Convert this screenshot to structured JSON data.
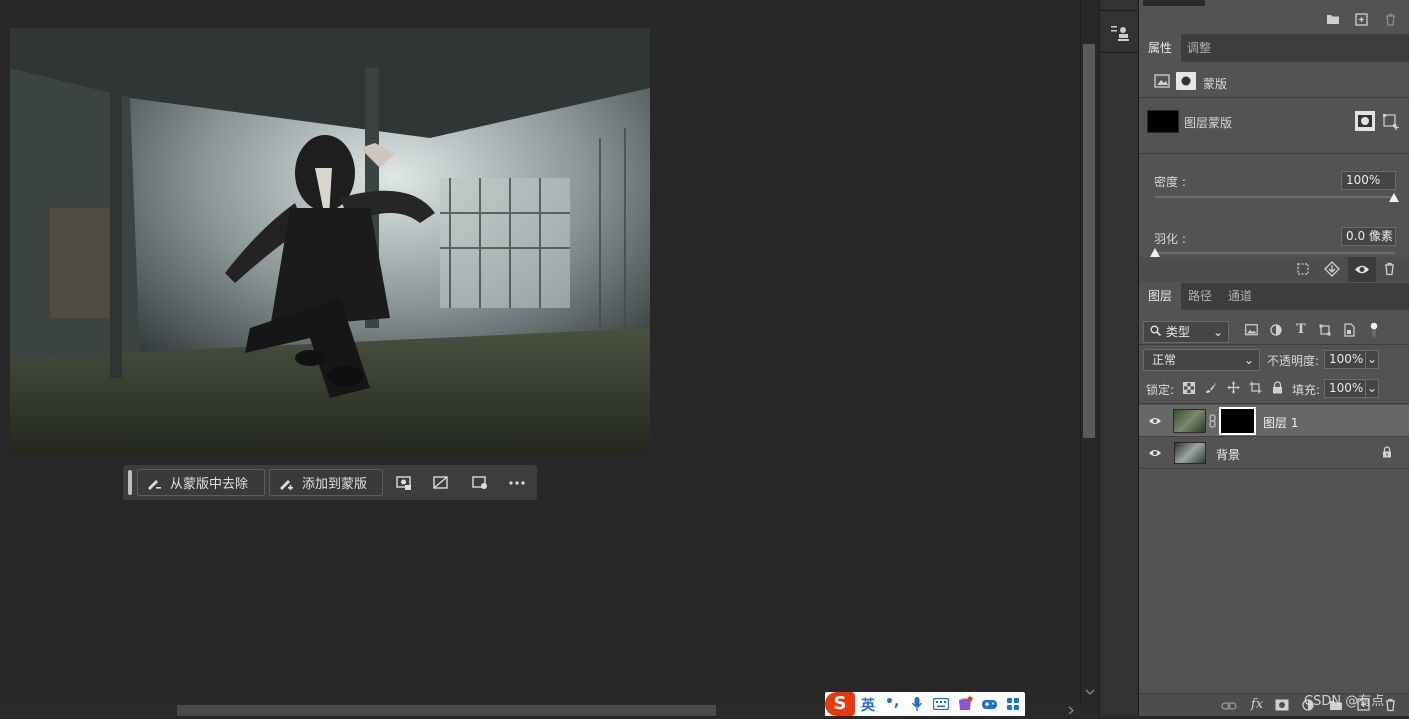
{
  "mask_toolbar": {
    "remove_label": "从蒙版中去除",
    "add_label": "添加到蒙版"
  },
  "properties_panel": {
    "tabs": [
      "属性",
      "调整"
    ],
    "header_label": "蒙版",
    "layer_mask_label": "图层蒙版",
    "density_label": "密度 :",
    "density_value": "100%",
    "feather_label": "羽化 :",
    "feather_value": "0.0 像素"
  },
  "layers_panel": {
    "tabs": [
      "图层",
      "路径",
      "通道"
    ],
    "filter_kind": "类型",
    "blend_mode": "正常",
    "opacity_label": "不透明度:",
    "opacity_value": "100%",
    "lock_label": "锁定:",
    "fill_label": "填充:",
    "fill_value": "100%",
    "layers": [
      {
        "name": "图层 1",
        "visible": true,
        "selected": true,
        "has_mask": true
      },
      {
        "name": "背景",
        "visible": true,
        "selected": false,
        "locked": true
      }
    ]
  },
  "ime_bar": {
    "mode_label": "英"
  },
  "watermark": "CSDN @有点",
  "colors": {
    "canvas_bg": "#282828",
    "panel_bg": "#535353",
    "tab_bar": "#3d3d3d",
    "selected_layer": "#676767",
    "ime_brand": "#e8380d"
  },
  "icons": [
    "brush-minus-icon",
    "brush-plus-icon",
    "mask-overlay-icon",
    "mask-invert-icon",
    "mask-settings-icon",
    "more-icon",
    "image-icon",
    "mask-icon",
    "selection-icon",
    "apply-mask-icon",
    "eye-icon",
    "trash-icon",
    "folder-icon",
    "new-layer-icon",
    "search-icon",
    "link-icon",
    "lock-icon",
    "fx-icon",
    "stamp-icon"
  ]
}
